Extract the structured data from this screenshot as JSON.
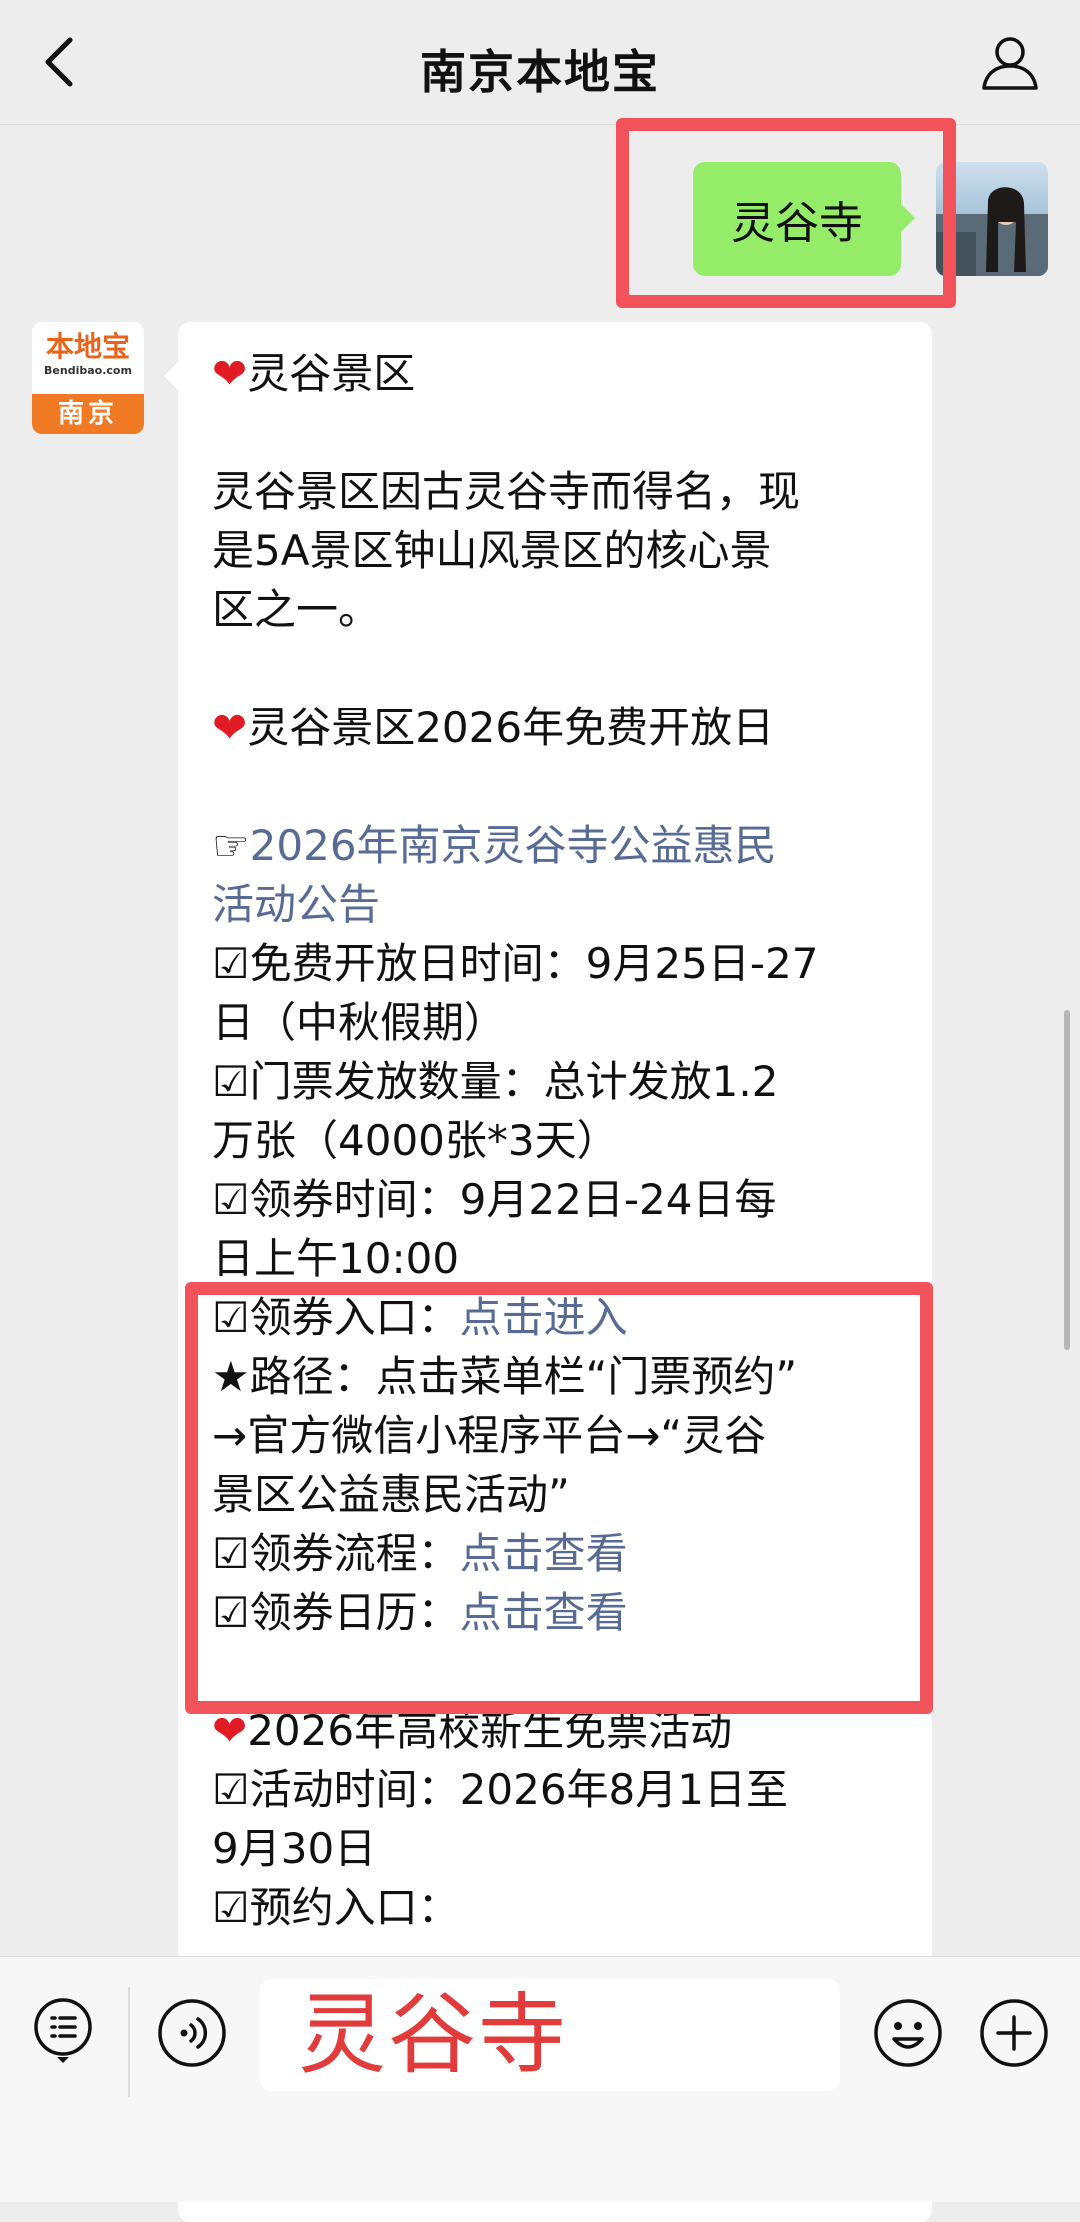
{
  "header": {
    "title": "南京本地宝"
  },
  "user_message": "灵谷寺",
  "bot": {
    "avatar_brand": "本地宝",
    "avatar_sub": "Bendibao.com",
    "avatar_city": "南京"
  },
  "lines": {
    "l1": "灵谷景区",
    "l2a": "灵谷景区因古灵谷寺而得名，现",
    "l2b": "是5A景区钟山风景区的核心景",
    "l2c": "区之一。",
    "l3": "灵谷景区2026年免费开放日",
    "link1_prefix": "☞",
    "link1a": "2026年南京灵谷寺公益惠民",
    "link1b": "活动公告",
    "l4a": "☑免费开放日时间：9月25日-27",
    "l4b": "日（中秋假期）",
    "l5a": "☑门票发放数量：总计发放1.2",
    "l5b": "万张（4000张*3天）",
    "l6a": "☑领券时间：9月22日-24日每",
    "l6b": "日上午10:00",
    "l7_label": "☑领券入口：",
    "l7_link": "点击进入",
    "l8a": "★路径：点击菜单栏“门票预约”",
    "l8b": "→官方微信小程序平台→“灵谷",
    "l8c": "景区公益惠民活动”",
    "l9_label": "☑领券流程：",
    "l9_link": "点击查看",
    "l10_label": "☑领券日历：",
    "l10_link": "点击查看",
    "l11": "2026年高校新生免票活动",
    "l12a": "☑活动时间：2026年8月1日至",
    "l12b": "9月30日",
    "l13": "☑预约入口："
  },
  "heart_glyph": "❤",
  "input": {
    "value": "灵谷寺"
  },
  "colors": {
    "user_bubble": "#95ec69",
    "link": "#576b95",
    "highlight": "#f2535a",
    "heart": "#e01b24",
    "input_text": "#e23b3b"
  }
}
